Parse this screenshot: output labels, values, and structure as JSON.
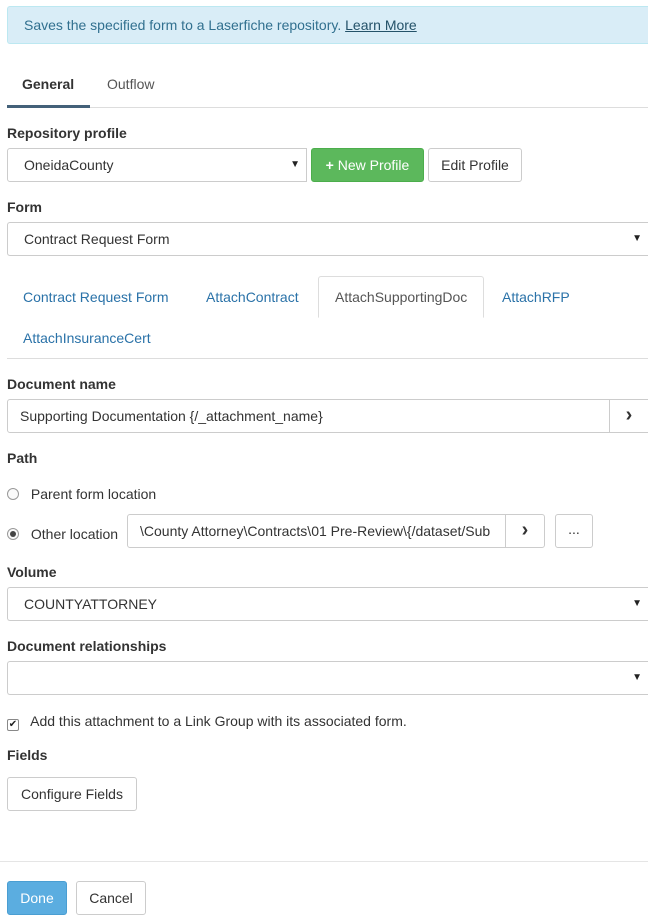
{
  "info": {
    "text": "Saves the specified form to a Laserfiche repository.",
    "link": "Learn More"
  },
  "tabs": {
    "general": "General",
    "outflow": "Outflow"
  },
  "repository": {
    "label": "Repository profile",
    "value": "OneidaCounty",
    "new_profile": "New Profile",
    "edit_profile": "Edit Profile"
  },
  "form": {
    "label": "Form",
    "value": "Contract Request Form"
  },
  "subtabs": [
    "Contract Request Form",
    "AttachContract",
    "AttachSupportingDoc",
    "AttachRFP",
    "AttachInsuranceCert"
  ],
  "document_name": {
    "label": "Document name",
    "value": "Supporting Documentation {/_attachment_name}",
    "arrow": "›"
  },
  "path": {
    "label": "Path",
    "parent_option": "Parent form location",
    "other_option": "Other location",
    "other_value": "\\County Attorney\\Contracts\\01 Pre-Review\\{/dataset/Sub",
    "arrow": "›",
    "browse": "..."
  },
  "volume": {
    "label": "Volume",
    "value": "COUNTYATTORNEY"
  },
  "relationships": {
    "label": "Document relationships",
    "value": ""
  },
  "link_group": {
    "checked": true,
    "text": "Add this attachment to a Link Group with its associated form."
  },
  "fields": {
    "label": "Fields",
    "configure": "Configure Fields"
  },
  "footer": {
    "done": "Done",
    "cancel": "Cancel"
  },
  "colors": {
    "accent_green": "#5cb85c",
    "accent_blue": "#5bade0",
    "link": "#2a72a8",
    "info_bg": "#d9edf7"
  }
}
